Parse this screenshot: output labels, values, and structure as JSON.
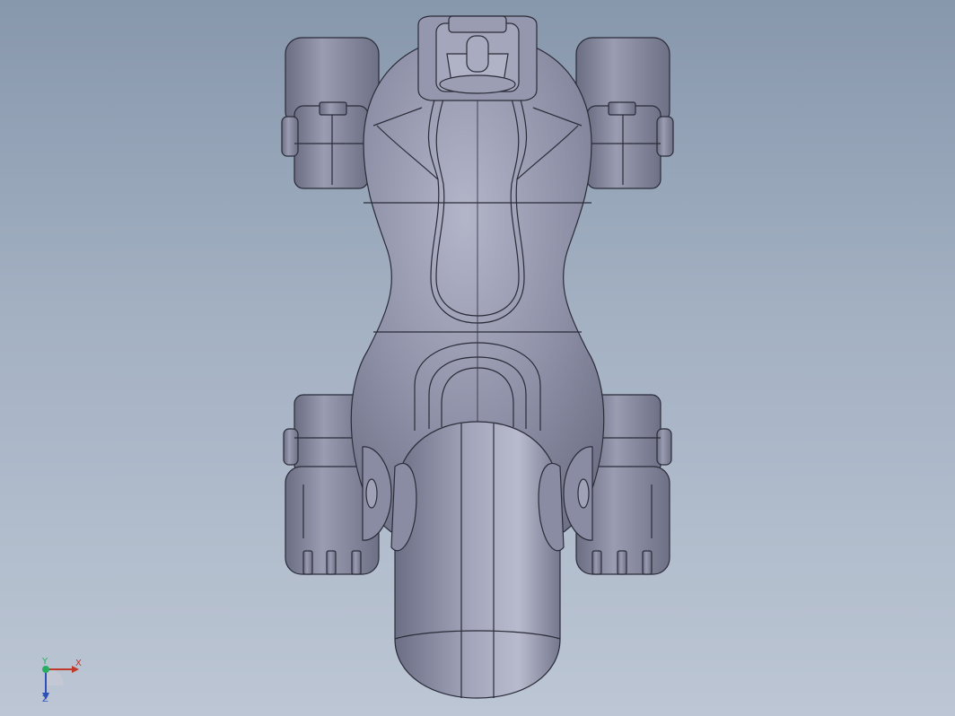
{
  "viewport": {
    "background_top": "#8797ac",
    "background_bottom": "#bcc6d4"
  },
  "model": {
    "part_color": "#8c8ea6",
    "edge_color": "#2a2c38"
  },
  "triad": {
    "x_label": "X",
    "y_label": "Y",
    "z_label": "Z",
    "x_color": "#c0392b",
    "y_color": "#27ae60",
    "z_color": "#2e4fb8"
  }
}
